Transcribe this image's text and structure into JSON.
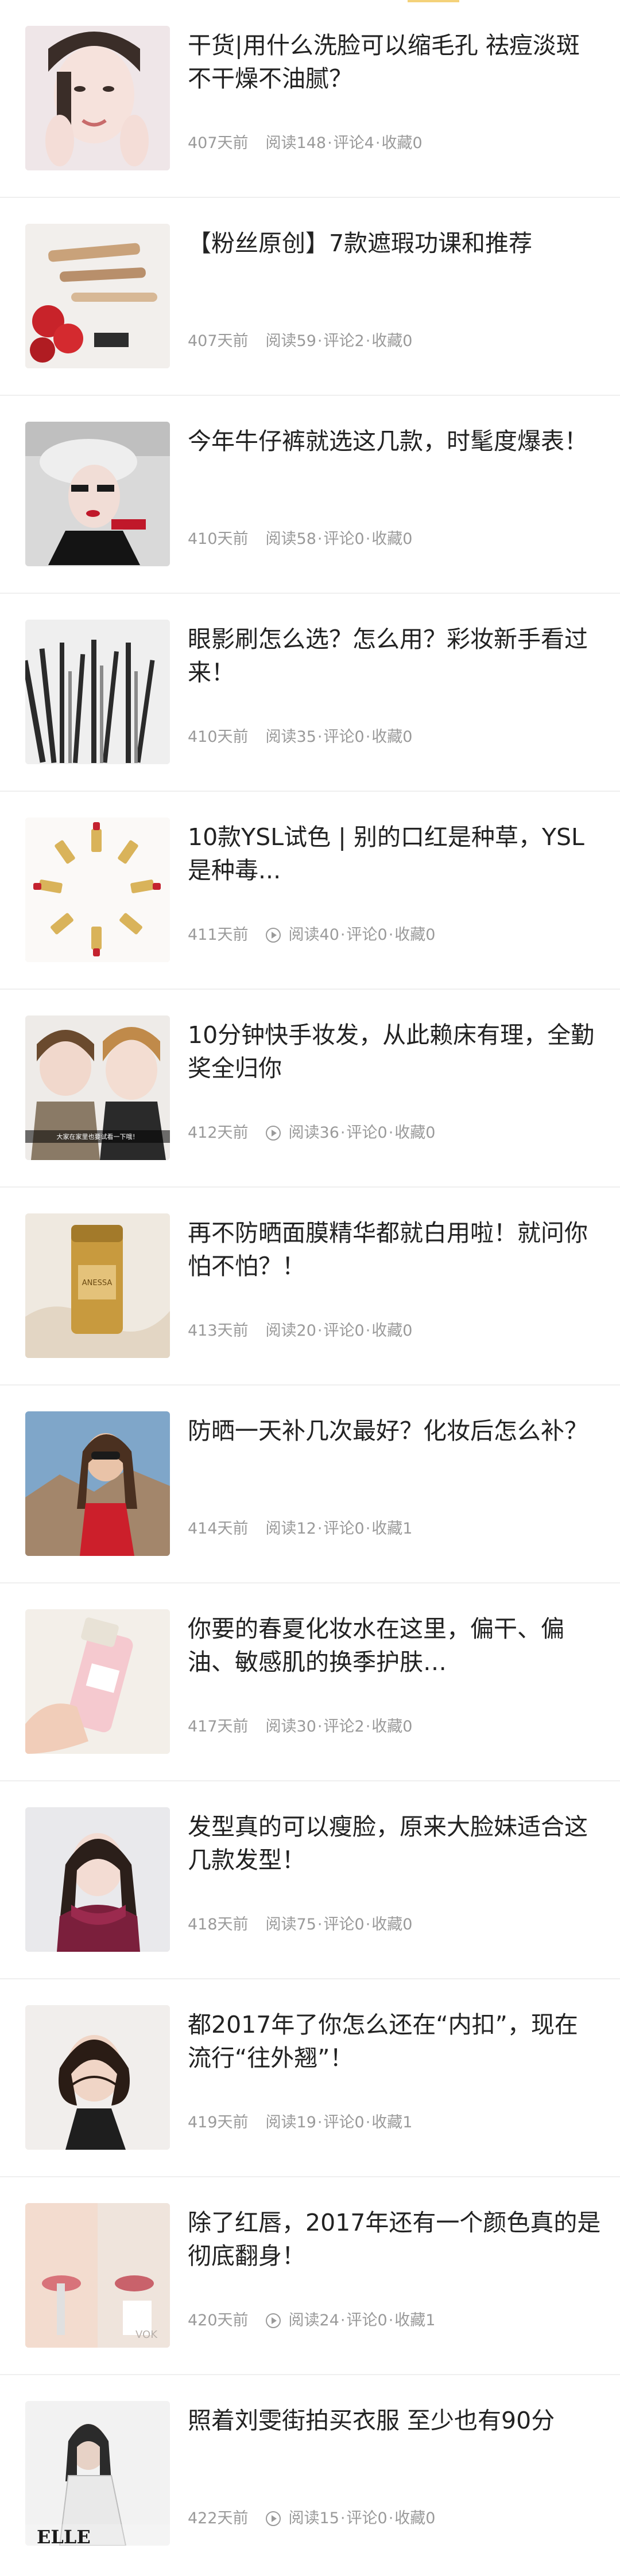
{
  "articles": [
    {
      "title": "干货|用什么洗脸可以缩毛孔 祛痘淡斑 不干燥不油腻？",
      "time": "407天前",
      "reads": "阅读148",
      "comments": "评论4",
      "saves": "收藏0",
      "video": false
    },
    {
      "title": "【粉丝原创】7款遮瑕功课和推荐",
      "time": "407天前",
      "reads": "阅读59",
      "comments": "评论2",
      "saves": "收藏0",
      "video": false
    },
    {
      "title": "今年牛仔裤就选这几款，时髦度爆表！",
      "time": "410天前",
      "reads": "阅读58",
      "comments": "评论0",
      "saves": "收藏0",
      "video": false
    },
    {
      "title": "眼影刷怎么选？怎么用？彩妆新手看过来！",
      "time": "410天前",
      "reads": "阅读35",
      "comments": "评论0",
      "saves": "收藏0",
      "video": false
    },
    {
      "title": "10款YSL试色 | 别的口红是种草，YSL是种毒...",
      "time": "411天前",
      "reads": "阅读40",
      "comments": "评论0",
      "saves": "收藏0",
      "video": true
    },
    {
      "title": "10分钟快手妆发，从此赖床有理，全勤奖全归你",
      "time": "412天前",
      "reads": "阅读36",
      "comments": "评论0",
      "saves": "收藏0",
      "video": true
    },
    {
      "title": "再不防晒面膜精华都就白用啦！就问你怕不怕？！",
      "time": "413天前",
      "reads": "阅读20",
      "comments": "评论0",
      "saves": "收藏0",
      "video": false
    },
    {
      "title": "防晒一天补几次最好？化妆后怎么补？",
      "time": "414天前",
      "reads": "阅读12",
      "comments": "评论0",
      "saves": "收藏1",
      "video": false
    },
    {
      "title": "你要的春夏化妆水在这里，偏干、偏油、敏感肌的换季护肤…",
      "time": "417天前",
      "reads": "阅读30",
      "comments": "评论2",
      "saves": "收藏0",
      "video": false
    },
    {
      "title": "发型真的可以瘦脸，原来大脸妹适合这几款发型！",
      "time": "418天前",
      "reads": "阅读75",
      "comments": "评论0",
      "saves": "收藏0",
      "video": false
    },
    {
      "title": "都2017年了你怎么还在“内扣”，现在流行“往外翘”！",
      "time": "419天前",
      "reads": "阅读19",
      "comments": "评论0",
      "saves": "收藏1",
      "video": false
    },
    {
      "title": "除了红唇，2017年还有一个颜色真的是彻底翻身！",
      "time": "420天前",
      "reads": "阅读24",
      "comments": "评论0",
      "saves": "收藏1",
      "video": true
    },
    {
      "title": "照着刘雯街拍买衣服 至少也有90分",
      "time": "422天前",
      "reads": "阅读15",
      "comments": "评论0",
      "saves": "收藏0",
      "video": true
    }
  ],
  "thumb_overlay_texts": {
    "t6": "大家在家里也要试看一下哦！",
    "t12": "VOK",
    "t13": "ELLE"
  },
  "colors": {
    "title": "#222222",
    "meta": "#9a9a9a",
    "divider": "#efefef"
  }
}
